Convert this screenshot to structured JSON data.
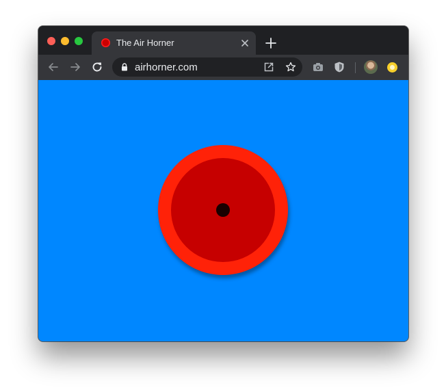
{
  "browser": {
    "tab": {
      "title": "The Air Horner",
      "favicon": "air-horner-favicon"
    },
    "omnibox": {
      "url": "airhorner.com"
    },
    "icons": {
      "back": "arrow-left-icon",
      "forward": "arrow-right-icon",
      "reload": "reload-icon",
      "lock": "lock-icon",
      "open_in_app": "open-in-window-icon",
      "bookmark": "star-icon",
      "screenshot_extension": "camera-icon",
      "shield_extension": "shield-icon",
      "profile": "avatar",
      "extension_badge": "yellow-extension-icon"
    }
  },
  "page": {
    "background_color": "#0087ff",
    "air_horn": {
      "outer_color": "#ff2208",
      "inner_color": "#c60000",
      "center_color": "#1a0000"
    }
  }
}
